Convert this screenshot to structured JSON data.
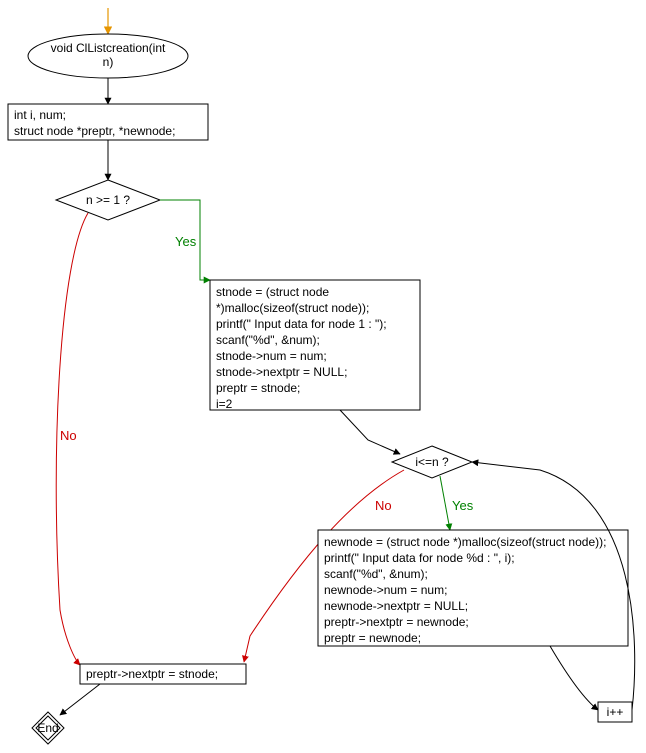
{
  "diagram": {
    "title": "void ClListcreation(int n)",
    "nodes": {
      "start": {
        "line1": "void ClListcreation(int",
        "line2": "n)"
      },
      "decl": {
        "line1": "int i, num;",
        "line2": "struct node *preptr, *newnode;"
      },
      "cond1": "n >= 1 ?",
      "block1": {
        "l1": "stnode = (struct node",
        "l2": "*)malloc(sizeof(struct node));",
        "l3": "printf(\" Input data for node 1 : \");",
        "l4": "scanf(\"%d\", &num);",
        "l5": "stnode->num = num;",
        "l6": "stnode->nextptr = NULL;",
        "l7": "preptr = stnode;",
        "l8": "i=2"
      },
      "cond2": "i<=n ?",
      "block2": {
        "l1": "newnode = (struct node *)malloc(sizeof(struct node));",
        "l2": "printf(\" Input data for node %d : \", i);",
        "l3": "scanf(\"%d\", &num);",
        "l4": "newnode->num = num;",
        "l5": "newnode->nextptr = NULL;",
        "l6": "preptr->nextptr = newnode;",
        "l7": "preptr = newnode;"
      },
      "incr": "i++",
      "block3": "preptr->nextptr = stnode;",
      "end": "End"
    },
    "edges": {
      "yes": "Yes",
      "no": "No"
    }
  }
}
